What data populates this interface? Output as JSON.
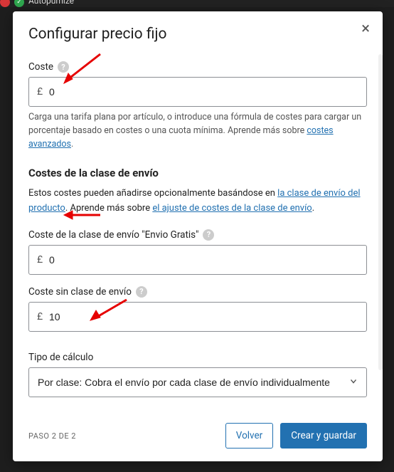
{
  "topbar": {
    "app_text": "Autopumize"
  },
  "modal": {
    "title": "Configurar precio fijo",
    "close_label": "×"
  },
  "cost": {
    "label": "Coste",
    "currency": "£",
    "value": "0",
    "hint_pre": "Carga una tarifa plana por artículo, o introduce una fórmula de costes para cargar un porcentaje basado en costes o una cuota mínima. Aprende más sobre ",
    "hint_link": "costes avanzados",
    "hint_post": "."
  },
  "shipping": {
    "section_title": "Costes de la clase de envío",
    "desc_pre": "Estos costes pueden añadirse opcionalmente basándose en ",
    "desc_link1": "la clase de envío del producto",
    "desc_mid": ". Aprende más sobre ",
    "desc_link2": "el ajuste de costes de la clase de envío",
    "desc_post": ".",
    "class_cost_label": "Coste de la clase de envío \"Envio Gratis\"",
    "class_cost_value": "0",
    "no_class_label": "Coste sin clase de envío",
    "no_class_value": "10"
  },
  "calc": {
    "label": "Tipo de cálculo",
    "selected": "Por clase: Cobra el envío por cada clase de envío individualmente"
  },
  "footer": {
    "step": "PASO 2 DE 2",
    "back": "Volver",
    "save": "Crear y guardar"
  }
}
